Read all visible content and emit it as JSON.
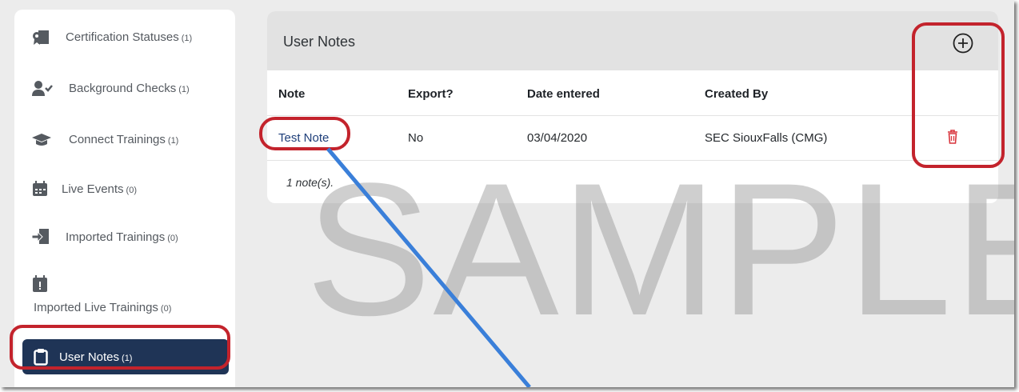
{
  "sidebar": {
    "items": [
      {
        "label": "Certification Statuses",
        "count": "(1)",
        "icon": "certificate-icon"
      },
      {
        "label": "Background Checks",
        "count": "(1)",
        "icon": "user-check-icon"
      },
      {
        "label": "Connect Trainings",
        "count": "(1)",
        "icon": "graduation-cap-icon"
      },
      {
        "label": "Live Events",
        "count": "(0)",
        "icon": "calendar-icon"
      },
      {
        "label": "Imported Trainings",
        "count": "(0)",
        "icon": "import-icon"
      },
      {
        "label": "Imported Live Trainings",
        "count": "(0)",
        "icon": "calendar-import-icon"
      },
      {
        "label": "User Notes",
        "count": "(1)",
        "icon": "clipboard-icon"
      }
    ]
  },
  "notes": {
    "title": "User Notes",
    "columns": [
      "Note",
      "Export?",
      "Date entered",
      "Created By"
    ],
    "rows": [
      {
        "note": "Test Note",
        "export": "No",
        "date": "03/04/2020",
        "created_by": "SEC SiouxFalls (CMG)"
      }
    ],
    "summary": "1 note(s)."
  },
  "watermark": "SAMPLE",
  "colors": {
    "active_nav": "#1f3456",
    "annotation": "#c3232c",
    "arrow": "#3a7fd9",
    "trash": "#d9363e"
  }
}
